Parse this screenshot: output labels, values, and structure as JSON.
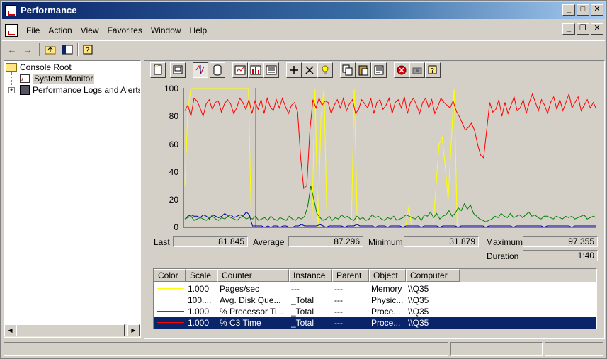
{
  "window": {
    "title": "Performance"
  },
  "menu": {
    "items": [
      "File",
      "Action",
      "View",
      "Favorites",
      "Window",
      "Help"
    ]
  },
  "tree": {
    "items": [
      {
        "label": "Console Root"
      },
      {
        "label": "System Monitor"
      },
      {
        "label": "Performance Logs and Alerts"
      }
    ]
  },
  "chart_data": {
    "type": "line",
    "y_ticks": [
      "100",
      "80",
      "60",
      "40",
      "20",
      "0"
    ],
    "ylim": [
      0,
      100
    ],
    "grid": false,
    "series": [
      {
        "name": "Pages/sec",
        "color": "#ffff00",
        "values": [
          30,
          85,
          100,
          100,
          100,
          100,
          100,
          100,
          100,
          100,
          100,
          100,
          100,
          100,
          100,
          100,
          100,
          100,
          100,
          100,
          100,
          100,
          0,
          0,
          0,
          0,
          0,
          0,
          0,
          0,
          0,
          0,
          0,
          0,
          0,
          0,
          0,
          0,
          0,
          0,
          0,
          0,
          0,
          100,
          0,
          80,
          100,
          0,
          0,
          0,
          0,
          0,
          0,
          0,
          0,
          0,
          100,
          0,
          0,
          0,
          0,
          0,
          0,
          0,
          0,
          0,
          0,
          0,
          0,
          0,
          0,
          0,
          0,
          0,
          15,
          0,
          0,
          0,
          0,
          0,
          0,
          0,
          0,
          30,
          60,
          65,
          45,
          20,
          60,
          100,
          0,
          0,
          0,
          0,
          0,
          0,
          0,
          0,
          0,
          0,
          0,
          0,
          0,
          0,
          0,
          0,
          0,
          0,
          0,
          0,
          0,
          0,
          0,
          0,
          0,
          0,
          0,
          0,
          0,
          0,
          0,
          0,
          0,
          0,
          0,
          0,
          0,
          0,
          0,
          0,
          0,
          0,
          0,
          0,
          0,
          0,
          0
        ]
      },
      {
        "name": "Avg. Disk Queue Length",
        "color": "#0000a0",
        "values": [
          6,
          8,
          9,
          8,
          8,
          7,
          9,
          8,
          6,
          9,
          8,
          7,
          8,
          10,
          8,
          9,
          7,
          8,
          9,
          8,
          11,
          9,
          1,
          1,
          1,
          1,
          0,
          1,
          0,
          1,
          1,
          0,
          1,
          1,
          0,
          0,
          1,
          1,
          2,
          1,
          1,
          1,
          1,
          1,
          2,
          1,
          0,
          1,
          1,
          1,
          1,
          1,
          0,
          1,
          1,
          1,
          2,
          1,
          1,
          1,
          1,
          1,
          0,
          1,
          1,
          1,
          0,
          1,
          1,
          1,
          1,
          0,
          1,
          1,
          1,
          1,
          1,
          0,
          1,
          1,
          1,
          1,
          1,
          0,
          1,
          1,
          1,
          1,
          1,
          0,
          1,
          1,
          1,
          1,
          1,
          1,
          1,
          1,
          0,
          1,
          1,
          1,
          1,
          1,
          1,
          1,
          1,
          0,
          1,
          1,
          1,
          1,
          1,
          1,
          1,
          1,
          1,
          0,
          1,
          1,
          1,
          1,
          1,
          1,
          1,
          1,
          0,
          1,
          1,
          1,
          1,
          1,
          1,
          1,
          1
        ]
      },
      {
        "name": "% Processor Time",
        "color": "#008000",
        "values": [
          6,
          7,
          8,
          5,
          6,
          7,
          6,
          5,
          7,
          8,
          6,
          5,
          7,
          6,
          8,
          7,
          6,
          5,
          7,
          8,
          6,
          7,
          6,
          8,
          5,
          6,
          7,
          5,
          8,
          6,
          5,
          7,
          6,
          5,
          8,
          6,
          5,
          7,
          6,
          8,
          15,
          30,
          20,
          10,
          7,
          5,
          6,
          8,
          5,
          7,
          6,
          9,
          7,
          8,
          6,
          5,
          8,
          6,
          7,
          5,
          6,
          9,
          7,
          8,
          6,
          5,
          7,
          6,
          8,
          5,
          6,
          7,
          9,
          8,
          7,
          6,
          8,
          5,
          9,
          8,
          11,
          7,
          10,
          6,
          8,
          9,
          12,
          8,
          10,
          14,
          12,
          17,
          13,
          16,
          10,
          8,
          6,
          5,
          4,
          5,
          6,
          8,
          7,
          10,
          8,
          7,
          10,
          7,
          8,
          9,
          7,
          9,
          11,
          8,
          9,
          7,
          6,
          8,
          8,
          7,
          6,
          8,
          7,
          6,
          8,
          7,
          8,
          6,
          7,
          8,
          9,
          6,
          7,
          8,
          7
        ]
      },
      {
        "name": "% C3 Time",
        "color": "#ff0000",
        "values": [
          84,
          88,
          80,
          93,
          91,
          86,
          80,
          89,
          92,
          85,
          90,
          91,
          83,
          89,
          92,
          89,
          82,
          86,
          93,
          90,
          85,
          92,
          82,
          91,
          85,
          92,
          82,
          93,
          87,
          84,
          92,
          86,
          93,
          87,
          82,
          88,
          90,
          83,
          50,
          28,
          30,
          70,
          92,
          86,
          93,
          88,
          91,
          90,
          82,
          88,
          92,
          86,
          93,
          84,
          89,
          92,
          82,
          85,
          92,
          89,
          86,
          93,
          82,
          90,
          92,
          85,
          88,
          93,
          82,
          90,
          92,
          86,
          94,
          82,
          90,
          93,
          88,
          82,
          90,
          93,
          86,
          92,
          82,
          87,
          93,
          90,
          88,
          86,
          91,
          84,
          80,
          75,
          70,
          72,
          75,
          70,
          60,
          52,
          50,
          70,
          90,
          83,
          85,
          92,
          80,
          90,
          82,
          88,
          94,
          84,
          86,
          92,
          82,
          90,
          96,
          90,
          84,
          92,
          88,
          82,
          90,
          94,
          85,
          92,
          84,
          90,
          96,
          86,
          90,
          94,
          84,
          88,
          92,
          86,
          90,
          85
        ]
      }
    ]
  },
  "stats": {
    "last_label": "Last",
    "last_value": "81.845",
    "average_label": "Average",
    "average_value": "87.296",
    "minimum_label": "Minimum",
    "minimum_value": "31.879",
    "maximum_label": "Maximum",
    "maximum_value": "97.355",
    "duration_label": "Duration",
    "duration_value": "1:40"
  },
  "legend": {
    "headers": [
      "Color",
      "Scale",
      "Counter",
      "Instance",
      "Parent",
      "Object",
      "Computer"
    ],
    "rows": [
      {
        "color": "#ffff00",
        "scale": "1.000",
        "counter": "Pages/sec",
        "instance": "---",
        "parent": "---",
        "object": "Memory",
        "computer": "\\\\Q35"
      },
      {
        "color": "#0000a0",
        "scale": "100....",
        "counter": "Avg. Disk Que...",
        "instance": "_Total",
        "parent": "---",
        "object": "Physic...",
        "computer": "\\\\Q35"
      },
      {
        "color": "#008000",
        "scale": "1.000",
        "counter": "% Processor Ti...",
        "instance": "_Total",
        "parent": "---",
        "object": "Proce...",
        "computer": "\\\\Q35"
      },
      {
        "color": "#ff0000",
        "scale": "1.000",
        "counter": "% C3 Time",
        "instance": "_Total",
        "parent": "---",
        "object": "Proce...",
        "computer": "\\\\Q35"
      }
    ]
  },
  "icons": {
    "new_counter_set": "new-counter-set-icon",
    "clear_display": "clear-display-icon",
    "view_current": "view-current-activity-icon",
    "view_log": "view-log-data-icon",
    "view_graph": "view-graph-icon",
    "view_histogram": "view-histogram-icon",
    "view_report": "view-report-icon",
    "add": "add-counter-icon",
    "delete": "delete-counter-icon",
    "highlight": "highlight-icon",
    "copy": "copy-properties-icon",
    "paste": "paste-counter-list-icon",
    "properties": "properties-icon",
    "freeze": "freeze-display-icon",
    "update": "update-data-icon",
    "help": "help-icon"
  }
}
